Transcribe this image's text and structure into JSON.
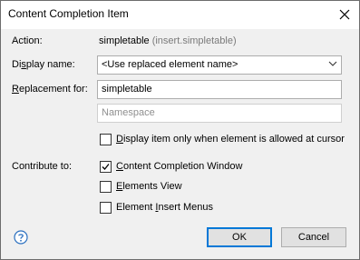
{
  "window": {
    "title": "Content Completion Item"
  },
  "action": {
    "label": "Action:",
    "value": "simpletable",
    "detail": "(insert.simpletable)"
  },
  "display_name": {
    "label_pre": "Di",
    "label_acc": "s",
    "label_post": "play name:",
    "value": "<Use replaced element name>"
  },
  "replacement": {
    "label_pre": "",
    "label_acc": "R",
    "label_post": "eplacement for:",
    "value": "simpletable",
    "namespace_placeholder": "Namespace"
  },
  "allowed_at_cursor": {
    "label_pre": "",
    "label_acc": "D",
    "label_post": "isplay item only when element is allowed at cursor",
    "checked": false
  },
  "contribute": {
    "label": "Contribute to:",
    "items": [
      {
        "label_pre": "",
        "label_acc": "C",
        "label_post": "ontent Completion Window",
        "checked": true
      },
      {
        "label_pre": "",
        "label_acc": "E",
        "label_post": "lements View",
        "checked": false
      },
      {
        "label_pre": "Element ",
        "label_acc": "I",
        "label_post": "nsert Menus",
        "checked": false
      }
    ]
  },
  "buttons": {
    "ok": "OK",
    "cancel": "Cancel"
  },
  "icons": {
    "close": "close-icon",
    "help": "help-icon",
    "dropdown": "chevron-down-icon",
    "check": "checkmark-icon"
  }
}
